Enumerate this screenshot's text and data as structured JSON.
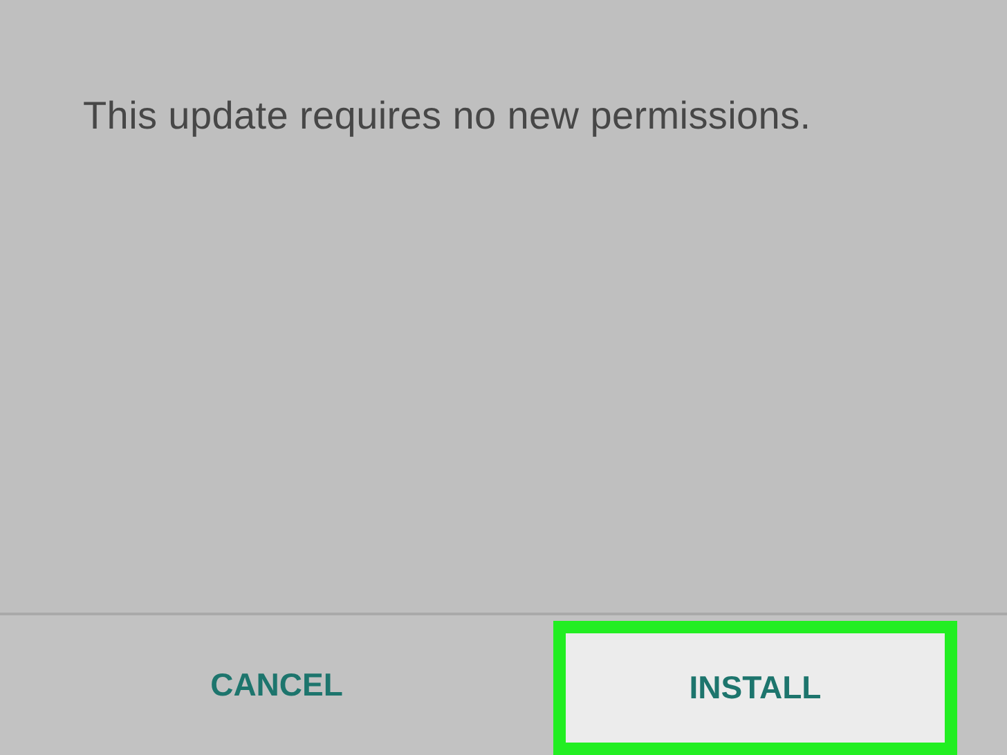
{
  "dialog": {
    "message": "This update requires no new permissions."
  },
  "buttons": [
    {
      "label": "CANCEL",
      "highlighted": false
    },
    {
      "label": "INSTALL",
      "highlighted": true
    }
  ]
}
